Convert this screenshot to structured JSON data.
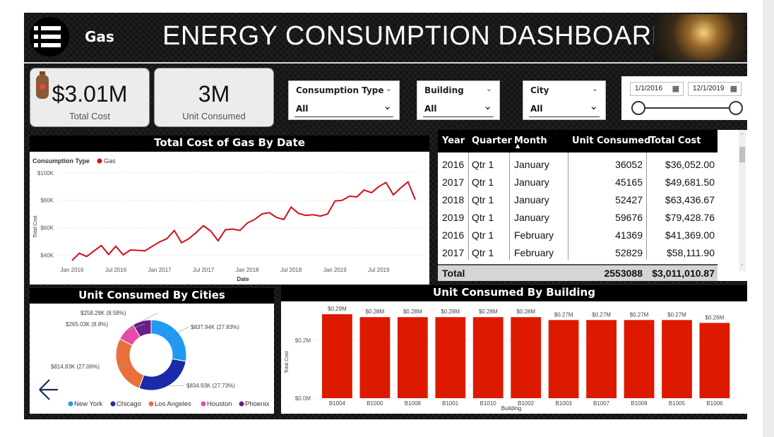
{
  "header": {
    "menu_icon": "hamburger-list-icon",
    "fuel_label": "Gas",
    "title": "ENERGY CONSUMPTION DASHBOARD",
    "image_icon": "light-bulb-plug-icon"
  },
  "cards": [
    {
      "value": "$3.01M",
      "label": "Total Cost",
      "icon": "gas-cylinder-icon"
    },
    {
      "value": "3M",
      "label": "Unit Consumed"
    }
  ],
  "slicers": [
    {
      "title": "Consumption Type",
      "value": "All"
    },
    {
      "title": "Building",
      "value": "All"
    },
    {
      "title": "City",
      "value": "All"
    }
  ],
  "date_range": {
    "start": "1/1/2016",
    "end": "12/1/2019"
  },
  "nav": {
    "back_icon": "back-arrow-icon"
  },
  "colors": {
    "accent_red": "#d0101a",
    "bar_red": "#dd1a00",
    "ny": "#1f9af0",
    "chicago": "#1b2aa8",
    "la": "#e8703a",
    "houston": "#e84aa8",
    "phoenix": "#6a1e8a"
  },
  "line_chart": {
    "title": "Total Cost of Gas By Date",
    "legend_title": "Consumption Type",
    "legend_item": "Gas",
    "xlabel": "Date",
    "ylabel": "Total Cost",
    "y_ticks": [
      "$40K",
      "$60K",
      "$80K",
      "$100K"
    ],
    "x_ticks": [
      "Jan 2016",
      "Jul 2016",
      "Jan 2017",
      "Jul 2017",
      "Jan 2018",
      "Jul 2018",
      "Jan 2019",
      "Jul 2019"
    ]
  },
  "table": {
    "columns": [
      "Year",
      "Quarter",
      "Month",
      "Unit Consumed",
      "Total Cost"
    ],
    "rows": [
      [
        "2016",
        "Qtr 1",
        "January",
        "36052",
        "$36,052.00"
      ],
      [
        "2017",
        "Qtr 1",
        "January",
        "45165",
        "$49,681.50"
      ],
      [
        "2018",
        "Qtr 1",
        "January",
        "52427",
        "$63,436.67"
      ],
      [
        "2019",
        "Qtr 1",
        "January",
        "59676",
        "$79,428.76"
      ],
      [
        "2016",
        "Qtr 1",
        "February",
        "41369",
        "$41,369.00"
      ],
      [
        "2017",
        "Qtr 1",
        "February",
        "52829",
        "$58,111.90"
      ]
    ],
    "total_label": "Total",
    "total_units": "2553088",
    "total_cost": "$3,011,010.87"
  },
  "donut": {
    "title": "Unit Consumed By Cities",
    "slice_labels": [
      "$837.94K (27.83%)",
      "$834.93K (27.73%)",
      "$814.83K (27.06%)",
      "$265.03K (8.8%)",
      "$258.28K (8.58%)"
    ],
    "legend": [
      "New York",
      "Chicago",
      "Los Angeles",
      "Houston",
      "Phoenix"
    ]
  },
  "bar_chart": {
    "title": "Unit Consumed By Building",
    "xlabel": "Building",
    "ylabel": "Total Cost",
    "y_ticks": [
      "$0.0M",
      "$0.2M"
    ]
  },
  "chart_data": [
    {
      "type": "line",
      "title": "Total Cost of Gas By Date",
      "xlabel": "Date",
      "ylabel": "Total Cost",
      "ylim": [
        33000,
        102000
      ],
      "x_start": "2016-01",
      "x_end": "2019-12",
      "series": [
        {
          "name": "Gas",
          "x": [
            "2016-01",
            "2016-02",
            "2016-03",
            "2016-04",
            "2016-05",
            "2016-06",
            "2016-07",
            "2016-08",
            "2016-09",
            "2016-10",
            "2016-11",
            "2016-12",
            "2017-01",
            "2017-02",
            "2017-03",
            "2017-04",
            "2017-05",
            "2017-06",
            "2017-07",
            "2017-08",
            "2017-09",
            "2017-10",
            "2017-11",
            "2017-12",
            "2018-01",
            "2018-02",
            "2018-03",
            "2018-04",
            "2018-05",
            "2018-06",
            "2018-07",
            "2018-08",
            "2018-09",
            "2018-10",
            "2018-11",
            "2018-12",
            "2019-01",
            "2019-02",
            "2019-03",
            "2019-04",
            "2019-05",
            "2019-06",
            "2019-07",
            "2019-08",
            "2019-09",
            "2019-10",
            "2019-11",
            "2019-12"
          ],
          "values": [
            36052,
            41369,
            39000,
            43000,
            47000,
            40500,
            46500,
            40200,
            43800,
            43500,
            43200,
            46500,
            49681,
            52000,
            58000,
            49000,
            52000,
            56500,
            61500,
            57500,
            50500,
            58500,
            59000,
            58000,
            63436,
            66000,
            70000,
            71000,
            67500,
            66000,
            75000,
            70500,
            69000,
            69500,
            68500,
            70000,
            79428,
            80000,
            83000,
            82500,
            87500,
            85500,
            90000,
            93000,
            84000,
            89000,
            93500,
            80500
          ]
        }
      ]
    },
    {
      "type": "table",
      "columns": [
        "Year",
        "Quarter",
        "Month",
        "Unit Consumed",
        "Total Cost"
      ],
      "rows": [
        [
          "2016",
          "Qtr 1",
          "January",
          36052,
          36052.0
        ],
        [
          "2017",
          "Qtr 1",
          "January",
          45165,
          49681.5
        ],
        [
          "2018",
          "Qtr 1",
          "January",
          52427,
          63436.67
        ],
        [
          "2019",
          "Qtr 1",
          "January",
          59676,
          79428.76
        ],
        [
          "2016",
          "Qtr 1",
          "February",
          41369,
          41369.0
        ],
        [
          "2017",
          "Qtr 1",
          "February",
          52829,
          58111.9
        ]
      ],
      "total": {
        "unit_consumed": 2553088,
        "total_cost": 3011010.87
      }
    },
    {
      "type": "pie",
      "title": "Unit Consumed By Cities",
      "categories": [
        "New York",
        "Chicago",
        "Los Angeles",
        "Houston",
        "Phoenix"
      ],
      "values": [
        837940,
        834930,
        814830,
        265030,
        258280
      ],
      "percents": [
        27.83,
        27.73,
        27.06,
        8.8,
        8.58
      ],
      "donut": true
    },
    {
      "type": "bar",
      "title": "Unit Consumed By Building",
      "xlabel": "Building",
      "ylabel": "Total Cost",
      "categories": [
        "B1004",
        "B1000",
        "B1008",
        "B1001",
        "B1010",
        "B1002",
        "B1003",
        "B1007",
        "B1009",
        "B1005",
        "B1006"
      ],
      "values": [
        0.29,
        0.28,
        0.28,
        0.28,
        0.28,
        0.28,
        0.27,
        0.27,
        0.27,
        0.27,
        0.26
      ],
      "labels": [
        "$0.29M",
        "$0.28M",
        "$0.28M",
        "$0.28M",
        "$0.28M",
        "$0.28M",
        "$0.27M",
        "$0.27M",
        "$0.27M",
        "$0.27M",
        "$0.26M"
      ],
      "ylim": [
        0,
        0.3
      ]
    }
  ]
}
